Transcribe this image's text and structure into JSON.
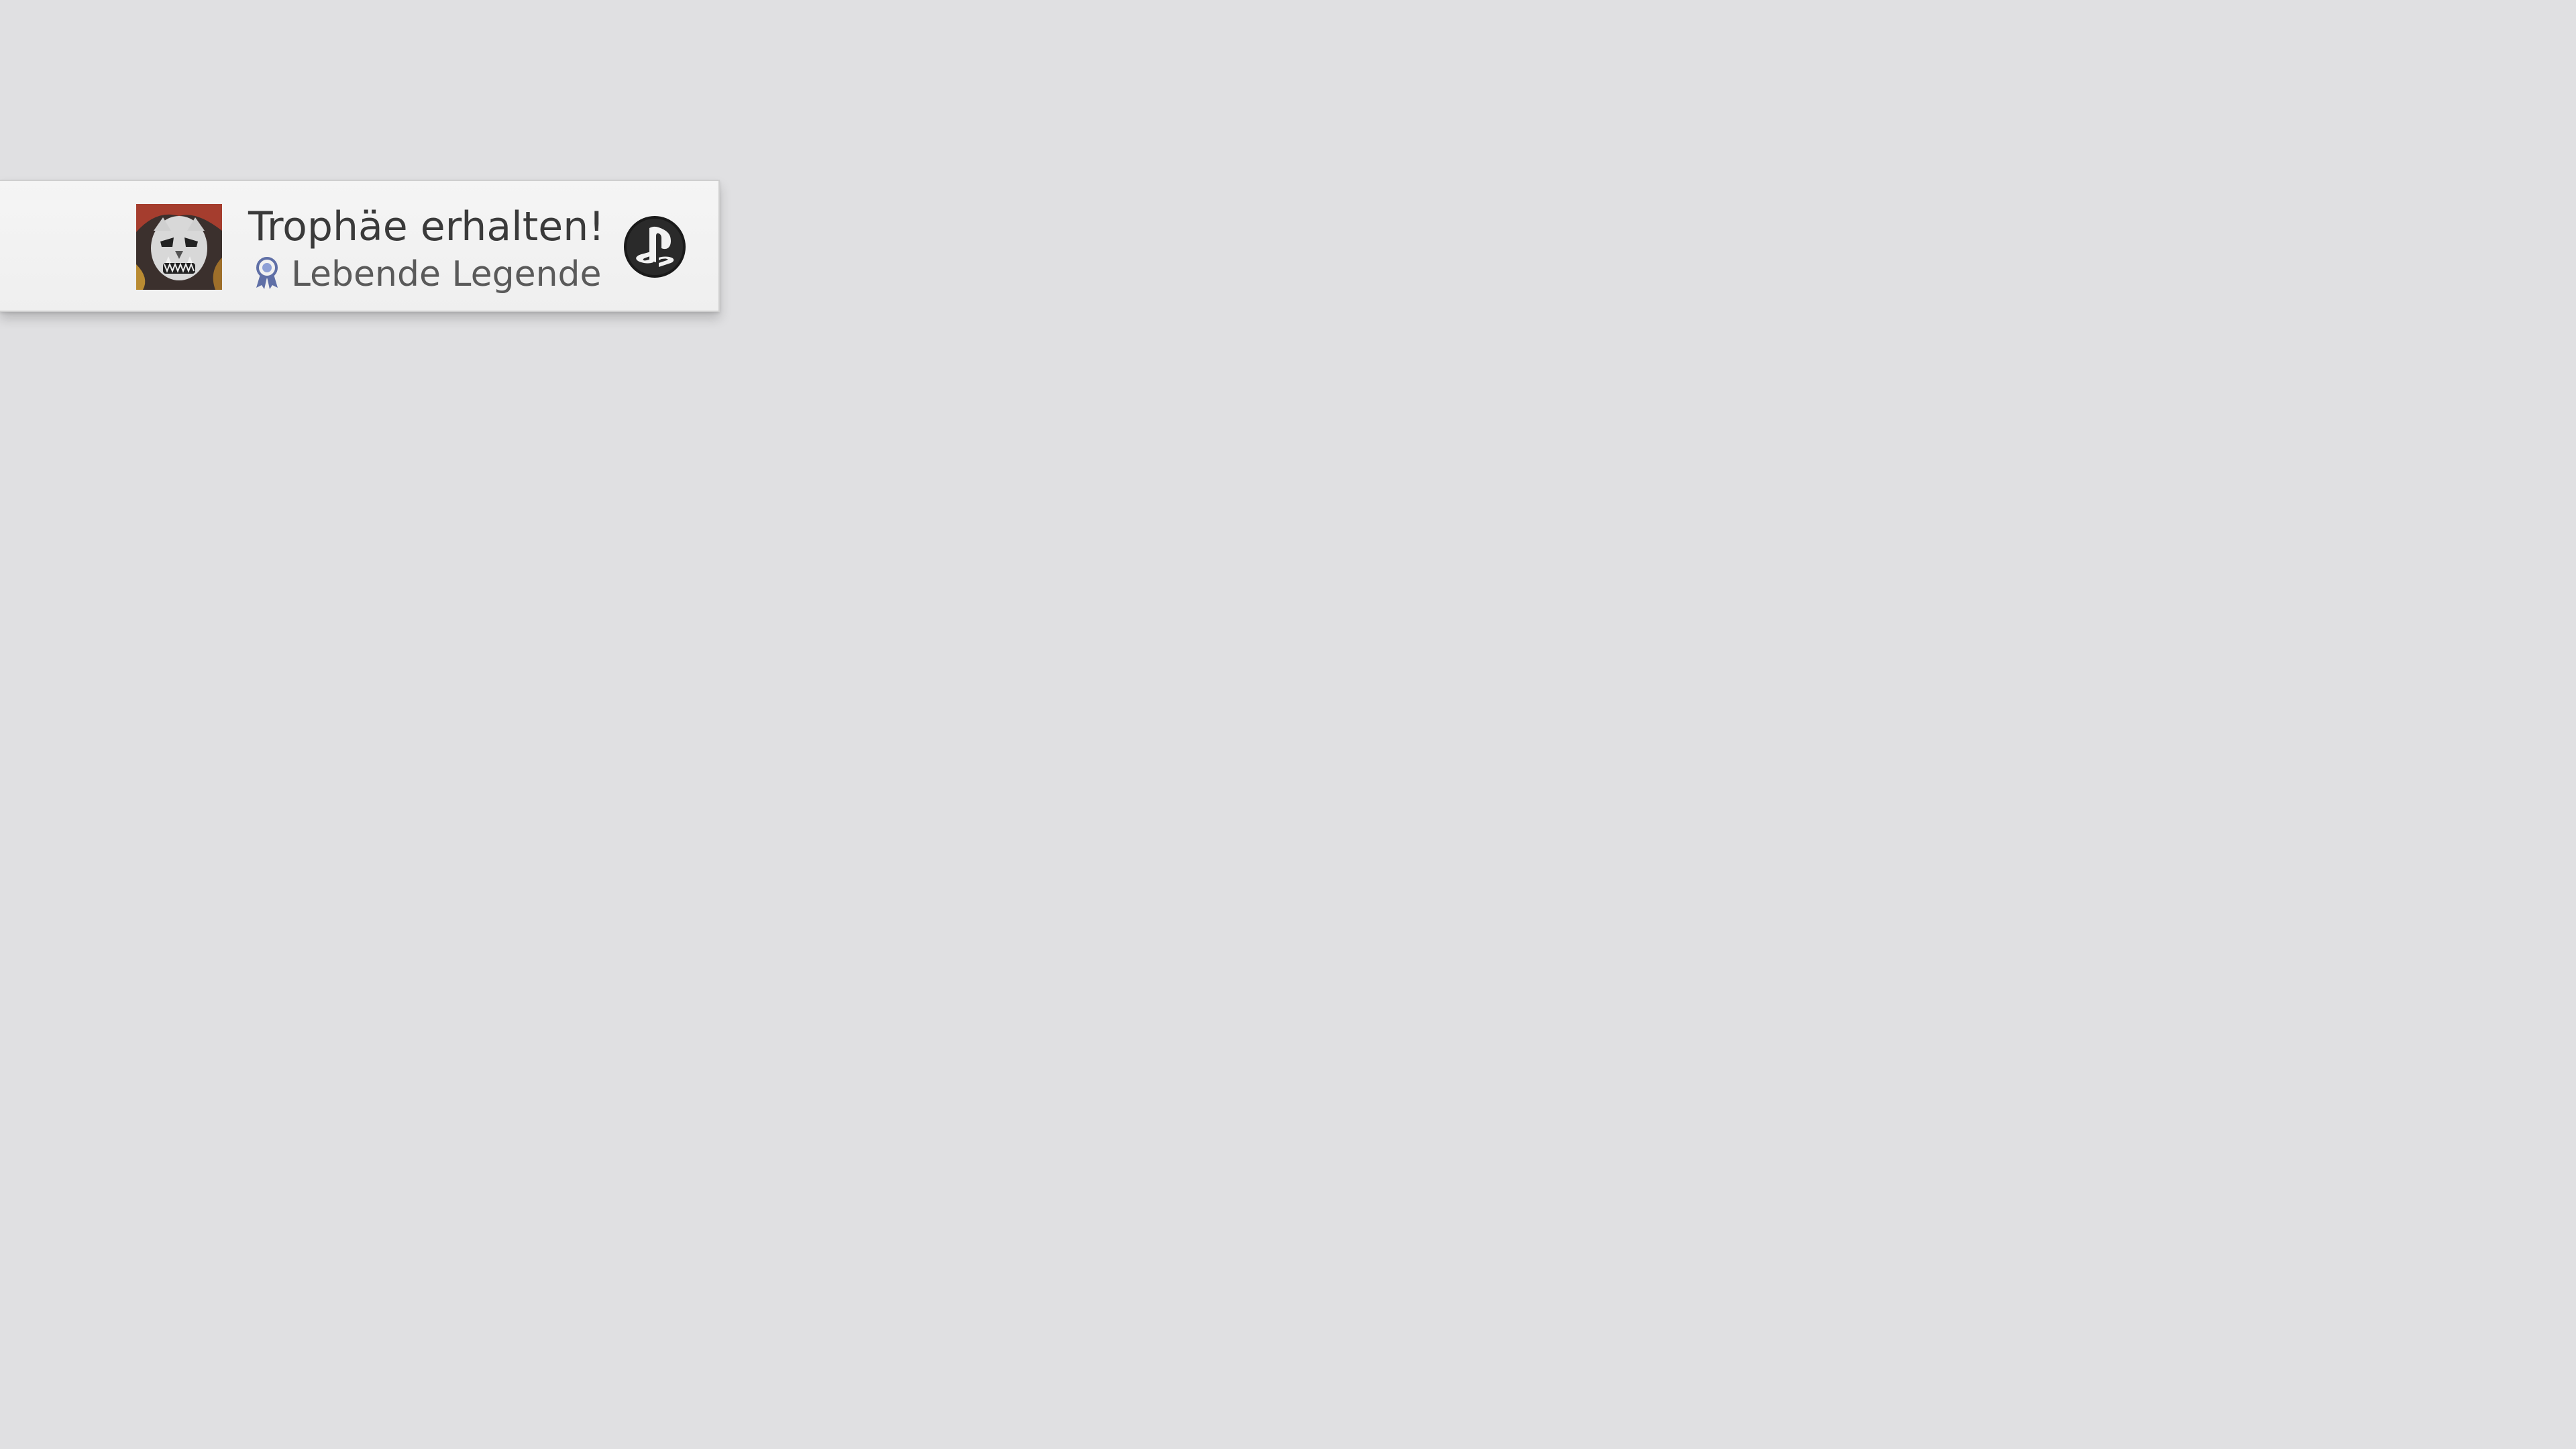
{
  "notification": {
    "title": "Trophäe erhalten!",
    "trophy_name": "Lebende Legende",
    "trophy_grade_icon": "platinum-trophy-icon",
    "game_icon": "oni-mask-game-icon",
    "platform_icon": "playstation-icon"
  },
  "colors": {
    "background": "#e0e0e2",
    "panel": "#f3f3f3",
    "title_text": "#3a3a3a",
    "subtitle_text": "#5a5a5a",
    "trophy_platinum": "#5f6fa6"
  }
}
